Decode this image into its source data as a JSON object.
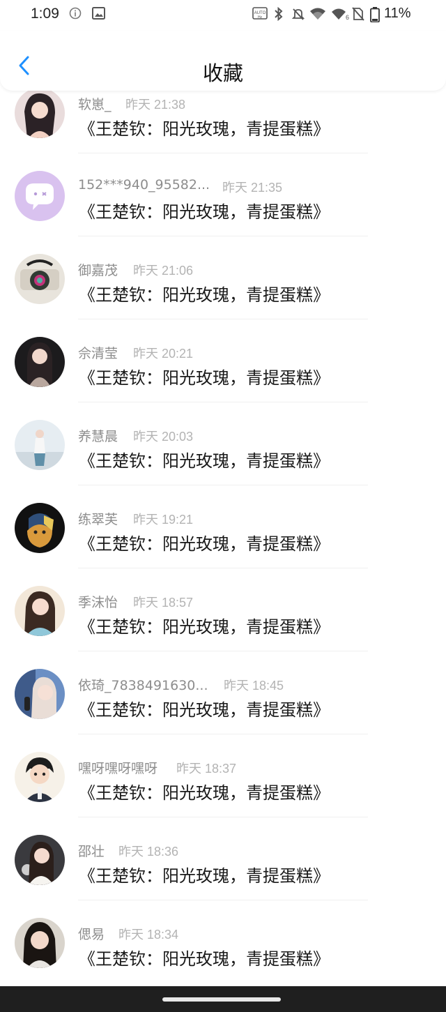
{
  "status_bar": {
    "time": "1:09",
    "battery": "11%",
    "icons": [
      "info-icon",
      "image-icon",
      "auto-hz-icon",
      "bluetooth-icon",
      "mute-icon",
      "wifi-icon",
      "wifi-6-icon",
      "no-sim-icon",
      "battery-icon"
    ]
  },
  "header": {
    "title": "收藏",
    "back_icon": "chevron-left-icon",
    "accent": "#1e90ff"
  },
  "items": [
    {
      "name": "软崽_",
      "time": "昨天 21:38",
      "content": "《王楚钦：阳光玫瑰，青提蛋糕》"
    },
    {
      "name": "152***940_95582...",
      "time": "昨天 21:35",
      "content": "《王楚钦：阳光玫瑰，青提蛋糕》"
    },
    {
      "name": "御嘉茂",
      "time": "昨天 21:06",
      "content": "《王楚钦：阳光玫瑰，青提蛋糕》"
    },
    {
      "name": "佘清莹",
      "time": "昨天 20:21",
      "content": "《王楚钦：阳光玫瑰，青提蛋糕》"
    },
    {
      "name": "养慧晨",
      "time": "昨天 20:03",
      "content": "《王楚钦：阳光玫瑰，青提蛋糕》"
    },
    {
      "name": "练翠芙",
      "time": "昨天 19:21",
      "content": "《王楚钦：阳光玫瑰，青提蛋糕》"
    },
    {
      "name": "季沫怡",
      "time": "昨天 18:57",
      "content": "《王楚钦：阳光玫瑰，青提蛋糕》"
    },
    {
      "name": "依琦_7838491630...",
      "time": "昨天 18:45",
      "content": "《王楚钦：阳光玫瑰，青提蛋糕》"
    },
    {
      "name": "嘿呀嘿呀嘿呀",
      "time": "昨天 18:37",
      "content": "《王楚钦：阳光玫瑰，青提蛋糕》"
    },
    {
      "name": "邵壮",
      "time": "昨天 18:36",
      "content": "《王楚钦：阳光玫瑰，青提蛋糕》"
    },
    {
      "name": "偲易",
      "time": "昨天 18:34",
      "content": "《王楚钦：阳光玫瑰，青提蛋糕》"
    }
  ]
}
